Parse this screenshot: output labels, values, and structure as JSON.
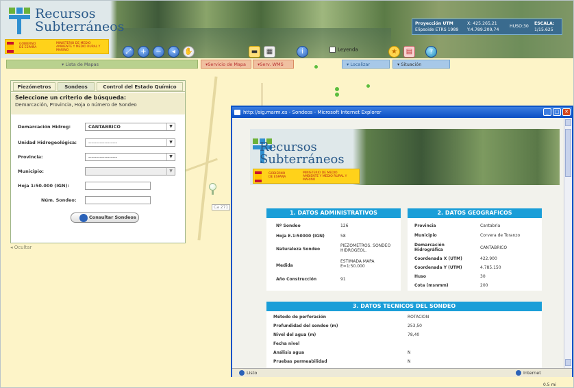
{
  "header": {
    "logo_line1": "Recursos",
    "logo_line2": "Subterráneos",
    "gov_left": "GOBIERNO DE ESPAÑA",
    "gov_right": "MINISTERIO DE MEDIO AMBIENTE Y MEDIO RURAL Y MARINO",
    "proj_label": "Proyección UTM",
    "proj_datum": "Elipsoide ETRS 1989",
    "x_label": "X:",
    "x_value": "425.265,21",
    "y_label": "Y:",
    "y_value": "4.789.209,74",
    "huso_label": "HUSO:",
    "huso_value": "30",
    "escala_label": "ESCALA:",
    "escala_value": "1/15.625",
    "leyenda": "Leyenda"
  },
  "menubar": {
    "lista_mapas": "▾ Lista de Mapas",
    "servicio_mapa": "▾Servicio de Mapa",
    "serv_wms": "▾Serv. WMS",
    "localizar": "▾ Localizar",
    "situacion": "▾ Situación"
  },
  "panel": {
    "tabs": [
      "Piezómetros",
      "Sondeos",
      "Control del Estado Químico"
    ],
    "criteria_title": "Seleccione un criterio de búsqueda:",
    "criteria_sub": "Demarcación, Provincia, Hoja o número de Sondeo",
    "fields": {
      "demarcacion_label": "Demarcación Hidrog:",
      "demarcacion_value": "CANTABRICO",
      "unidad_label": "Unidad Hidrogeológica:",
      "unidad_value": "------------------",
      "provincia_label": "Provincia:",
      "provincia_value": "------------------",
      "municipio_label": "Municipio:",
      "hoja_label": "Hoja 1:50.000 (IGN):",
      "sondeo_label": "Núm. Sondeo:"
    },
    "consultar": "Consultar Sondeos",
    "ocultar": "◂ Ocultar"
  },
  "map": {
    "label_ca": "Ca 271"
  },
  "ie": {
    "title": "http://sig.marm.es - Sondeos - Microsoft Internet Explorer",
    "status_left": "Listo",
    "status_right": "Internet",
    "scale": "0.5 mi",
    "sec1_title": "1. DATOS ADMINISTRATIVOS",
    "sec1": [
      {
        "k": "Nº Sondeo",
        "v": "126"
      },
      {
        "k": "Hoja E.1:50000 (IGN)",
        "v": "58"
      },
      {
        "k": "Naturaleza Sondeo",
        "v": "PIEZOMETROS. SONDEO HIDROGEOL."
      },
      {
        "k": "Medida",
        "v": "ESTIMADA MAPA E=1:50.000"
      },
      {
        "k": "Año Construcción",
        "v": "91"
      }
    ],
    "sec2_title": "2. DATOS GEOGRAFICOS",
    "sec2": [
      {
        "k": "Provincia",
        "v": "Cantabria"
      },
      {
        "k": "Municipio",
        "v": "Corvera de Toranzo"
      },
      {
        "k": "Demarcación Hidrográfica",
        "v": "CANTABRICO"
      },
      {
        "k": "Coordenada X (UTM)",
        "v": "422.900"
      },
      {
        "k": "Coordenada Y (UTM)",
        "v": "4.785.150"
      },
      {
        "k": "Huso",
        "v": "30"
      },
      {
        "k": "Cota (msnmm)",
        "v": "200"
      }
    ],
    "sec3_title": "3. DATOS TECNICOS DEL SONDEO",
    "sec3": [
      {
        "k": "Método de perforación",
        "v": "ROTACION"
      },
      {
        "k": "Profundidad del sondeo (m)",
        "v": "253,50"
      },
      {
        "k": "Nivel del agua (m)",
        "v": "78,40"
      },
      {
        "k": "Fecha nivel",
        "v": ""
      },
      {
        "k": "Análisis agua",
        "v": "N"
      },
      {
        "k": "Pruebas permeabilidad",
        "v": "N"
      }
    ]
  }
}
